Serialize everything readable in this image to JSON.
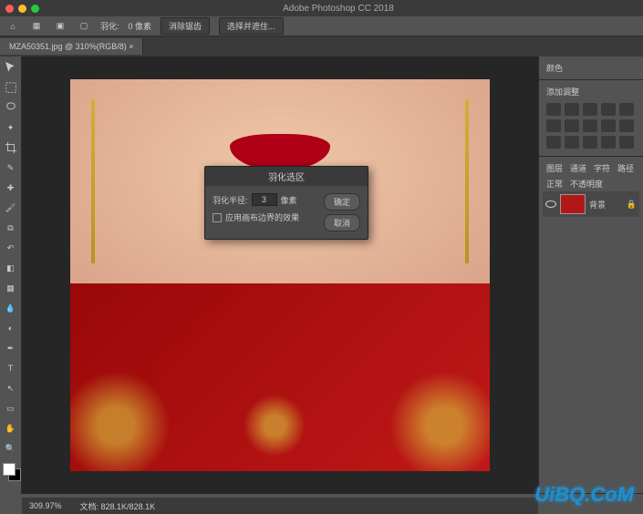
{
  "app": {
    "title": "Adobe Photoshop CC 2018"
  },
  "toolbar": {
    "feather_label": "羽化:",
    "feather_value": "0 像素",
    "btn1": "消除锯齿",
    "btn2": "选择并遮住..."
  },
  "tabs": {
    "active": "MZA50351.jpg @ 310%(RGB/8) ×"
  },
  "dialog": {
    "title": "羽化选区",
    "radius_label": "羽化半径:",
    "radius_value": "3",
    "unit": "像素",
    "checkbox": "应用画布边界的效果",
    "ok": "确定",
    "cancel": "取消"
  },
  "panels": {
    "color_tab": "颜色",
    "adjust_tab": "添加调整",
    "layers": {
      "tab1": "图层",
      "tab2": "通道",
      "tab3": "字符",
      "tab4": "路径"
    },
    "filter": "正常",
    "opacity_label": "不透明度",
    "layer_name": "背景"
  },
  "status": {
    "zoom": "309.97%",
    "doc": "文档: 828.1K/828.1K"
  },
  "watermark": "UiBQ.CoM"
}
